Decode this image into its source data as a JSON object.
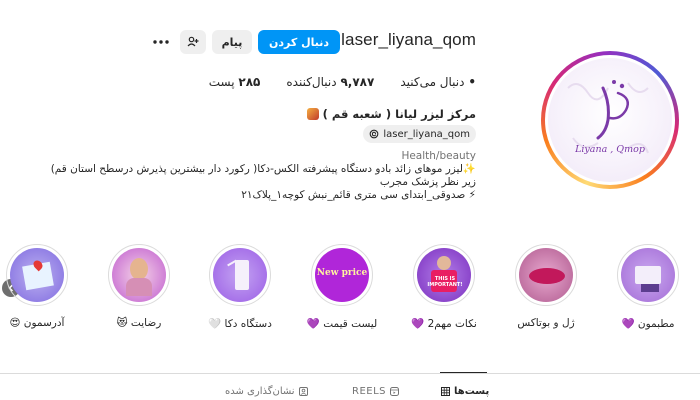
{
  "profile": {
    "username": "laser_liyana_qom",
    "follow_label": "دنبال کردن",
    "message_label": "پیام",
    "posts_count": "۲۸۵",
    "posts_label": "پست",
    "followers_count": "۹,۷۸۷",
    "followers_label": "دنبال‌کننده",
    "following_count": "•",
    "following_label": "دنبال می‌کنید",
    "full_name": "مرکز لیزر لیانا ( شعبه قم )",
    "threads_handle": "laser_liyana_qom",
    "category": "Health/beauty",
    "bio_lines": [
      "✨لیزر موهای زائد بادو دستگاه پیشرفته الکس-دکا( رکورد دار بیشترین پذیرش درسطح استان قم)",
      "زیر نظر پزشک مجرب",
      "⚡ صدوقی_ابتدای سی متری قائم_نبش کوچه۱_پلاک۲۱"
    ],
    "avatar_text": "Liyana , Qmop"
  },
  "highlights": [
    {
      "label": "مطبمون 💜",
      "color": "#a36bd6"
    },
    {
      "label": "ژل و بوتاکس",
      "color": "#d478b8"
    },
    {
      "label": "نکات مهم2 💜",
      "color": "#8a3fcf"
    },
    {
      "label": "لیست قیمت 💜",
      "color": "#b026d9"
    },
    {
      "label": "دستگاه دکا 🤍",
      "color": "#9b5de5"
    },
    {
      "label": "رضایت 😻",
      "color": "#c05ccf"
    },
    {
      "label": "آدرسمون 😍",
      "color": "#7f6ae0"
    }
  ],
  "highlight_texts": {
    "new_price": "New price",
    "this_is_important": "THIS IS IMPORTANT!"
  },
  "tabs": [
    {
      "label": "پست‌ها",
      "icon": "grid-icon"
    },
    {
      "label": "REELS",
      "icon": "reels-icon"
    },
    {
      "label": "نشان‌گذاری شده",
      "icon": "tagged-icon"
    }
  ]
}
